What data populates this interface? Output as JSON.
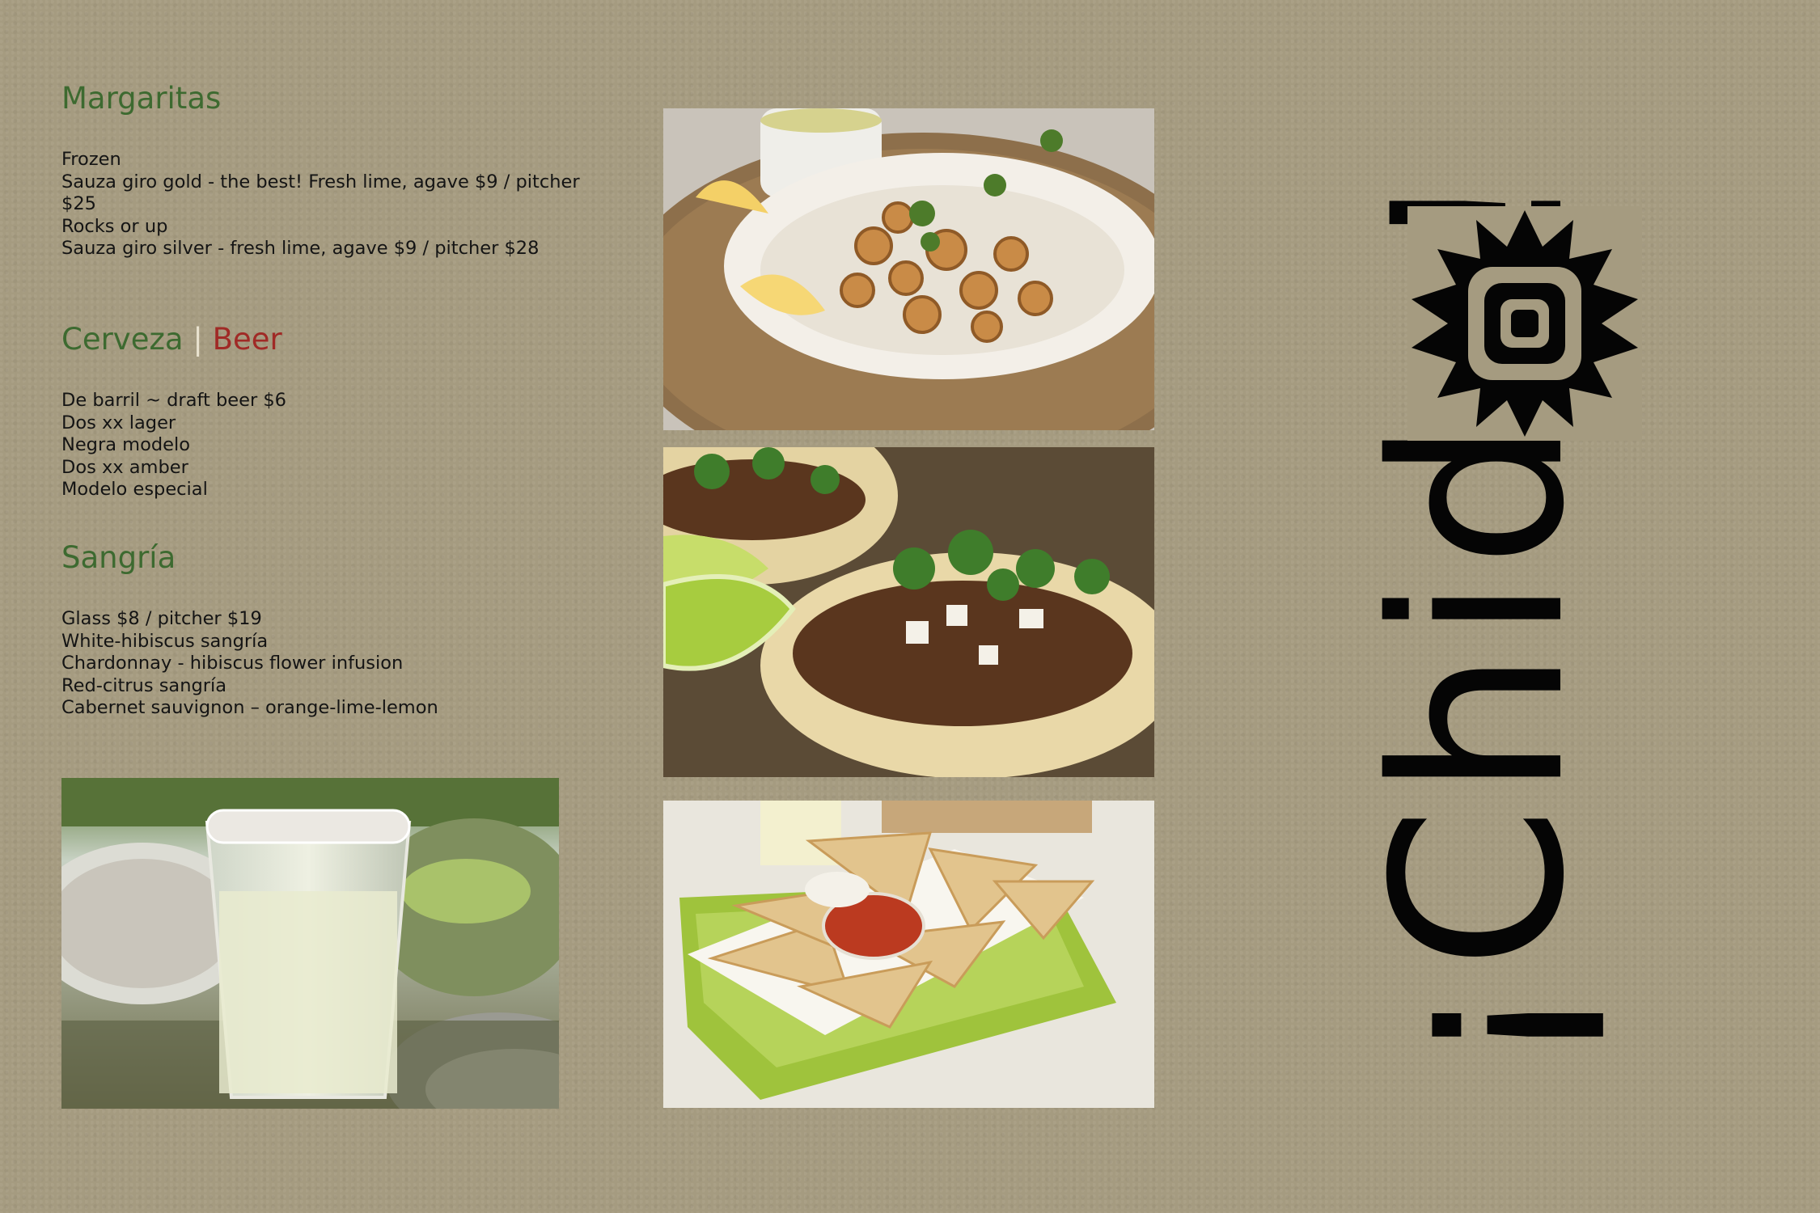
{
  "margaritas": {
    "title": "Margaritas",
    "lines": [
      "Frozen",
      "Sauza giro gold - the best! Fresh lime, agave $9 / pitcher",
      "$25",
      "Rocks or up",
      "Sauza giro silver - fresh lime, agave $9 / pitcher $28"
    ]
  },
  "beer": {
    "title_spanish": "Cerveza",
    "separator": "|",
    "title_english": "Beer",
    "lines": [
      "De barril ~ draft beer $6",
      "Dos xx lager",
      "Negra modelo",
      "Dos xx amber",
      "Modelo especial"
    ]
  },
  "sangria": {
    "title": "Sangría",
    "lines": [
      "Glass $8 / pitcher $19",
      "White-hibiscus sangría",
      "Chardonnay - hibiscus flower infusion",
      "Red-citrus sangría",
      "Cabernet sauvignon – orange-lime-lemon"
    ]
  },
  "logo": {
    "text": "¡Chido!",
    "icon": "sun-icon"
  },
  "colors": {
    "paper": "#a59b80",
    "green_heading": "#3d6a30",
    "red_heading": "#a02a26",
    "ink": "#141414"
  }
}
